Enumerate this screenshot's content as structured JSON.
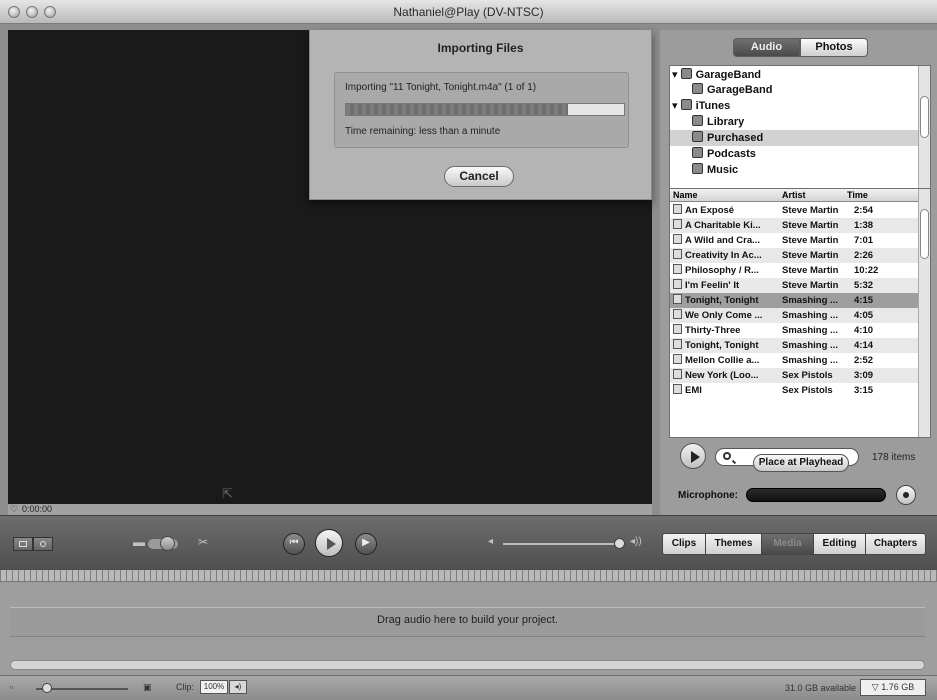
{
  "window": {
    "title": "Nathaniel@Play (DV-NTSC)"
  },
  "dialog": {
    "title": "Importing Files",
    "importing_text": "Importing \"11 Tonight, Tonight.m4a\"    (1 of 1)",
    "progress": 0.8,
    "time_remaining": "Time remaining: less than a minute",
    "cancel_label": "Cancel"
  },
  "media": {
    "toggle": {
      "audio": "Audio",
      "photos": "Photos"
    },
    "sources": [
      {
        "label": "GarageBand",
        "icon": "garageband-icon",
        "level": 0,
        "expanded": true
      },
      {
        "label": "GarageBand",
        "icon": "folder-icon",
        "level": 1
      },
      {
        "label": "iTunes",
        "icon": "itunes-icon",
        "level": 0,
        "expanded": true
      },
      {
        "label": "Library",
        "icon": "library-icon",
        "level": 1
      },
      {
        "label": "Purchased",
        "icon": "playlist-icon",
        "level": 1,
        "selected": true
      },
      {
        "label": "Podcasts",
        "icon": "podcast-icon",
        "level": 1
      },
      {
        "label": "Music",
        "icon": "playlist-icon",
        "level": 1
      }
    ],
    "columns": [
      "Name",
      "Artist",
      "Time"
    ],
    "songs": [
      {
        "name": "An Exposé",
        "artist": "Steve Martin",
        "time": "2:54"
      },
      {
        "name": "A Charitable Ki...",
        "artist": "Steve Martin",
        "time": "1:38"
      },
      {
        "name": "A Wild and Cra...",
        "artist": "Steve Martin",
        "time": "7:01"
      },
      {
        "name": "Creativity In Ac...",
        "artist": "Steve Martin",
        "time": "2:26"
      },
      {
        "name": "Philosophy / R...",
        "artist": "Steve Martin",
        "time": "10:22"
      },
      {
        "name": "I'm Feelin' It",
        "artist": "Steve Martin",
        "time": "5:32"
      },
      {
        "name": "Tonight, Tonight",
        "artist": "Smashing ...",
        "time": "4:15",
        "selected": true
      },
      {
        "name": "We Only Come ...",
        "artist": "Smashing ...",
        "time": "4:05"
      },
      {
        "name": "Thirty-Three",
        "artist": "Smashing ...",
        "time": "4:10"
      },
      {
        "name": "Tonight, Tonight",
        "artist": "Smashing ...",
        "time": "4:14"
      },
      {
        "name": "Mellon Collie a...",
        "artist": "Smashing ...",
        "time": "2:52"
      },
      {
        "name": "New York (Loo...",
        "artist": "Sex Pistols",
        "time": "3:09"
      },
      {
        "name": "EMI",
        "artist": "Sex Pistols",
        "time": "3:15"
      }
    ],
    "items_count": "178 items",
    "place_at_playhead": "Place at Playhead",
    "microphone_label": "Microphone:"
  },
  "timecode": "0:00:00",
  "toolbar": {
    "tabs": [
      {
        "label": "Clips"
      },
      {
        "label": "Themes"
      },
      {
        "label": "Media",
        "active": true
      },
      {
        "label": "Editing"
      },
      {
        "label": "Chapters"
      }
    ]
  },
  "project": {
    "drag_text": "Drag audio here to build your project."
  },
  "bottom": {
    "clip_label": "Clip:",
    "clip_value": "100%",
    "disk_available": "31.0 GB available",
    "project_size": "1.76 GB"
  }
}
